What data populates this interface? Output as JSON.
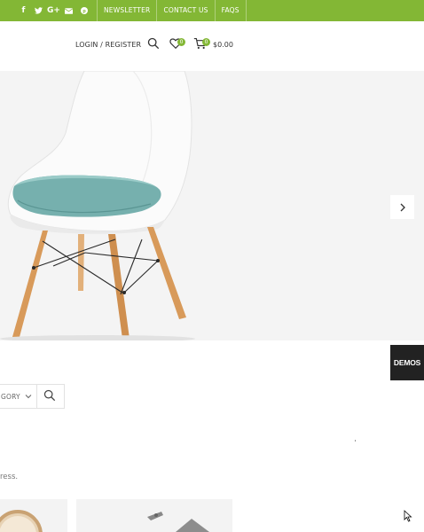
{
  "topbar": {
    "social_icons": [
      {
        "name": "facebook-icon",
        "glyph": "f"
      },
      {
        "name": "twitter-icon",
        "glyph": "t"
      },
      {
        "name": "google-plus-icon",
        "glyph": "G+"
      },
      {
        "name": "email-icon",
        "glyph": "✉"
      },
      {
        "name": "pinterest-icon",
        "glyph": "℗"
      }
    ],
    "nav": [
      "NEWSLETTER",
      "CONTACT US",
      "FAQS"
    ],
    "color": "#83b735"
  },
  "header": {
    "login_label": "LOGIN / REGISTER",
    "wishlist_count": "0",
    "cart_count": "0",
    "cart_total": "$0.00"
  },
  "hero": {
    "background": "#f4f4f4",
    "next_icon": "chevron-right-icon"
  },
  "demos_label": "DEMOS",
  "search": {
    "category_label": "GORY",
    "category_icon": "chevron-down-icon",
    "button_icon": "search-icon"
  },
  "note_text": "ress."
}
